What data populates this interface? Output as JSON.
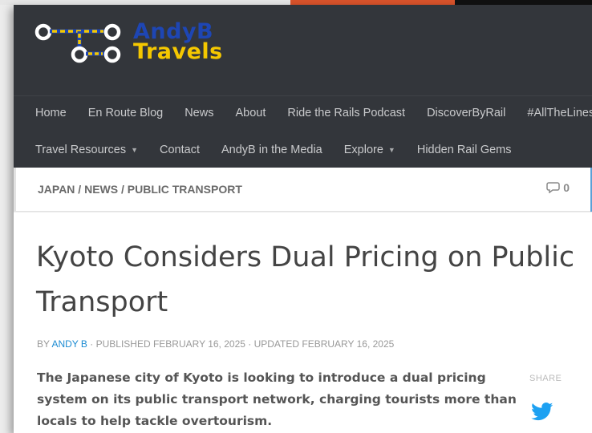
{
  "brand": {
    "line1": "AndyB",
    "line2": "Travels"
  },
  "nav_primary": [
    "Home",
    "En Route Blog",
    "News",
    "About",
    "Ride the Rails Podcast",
    "DiscoverByRail",
    "#AllTheLinesBy"
  ],
  "nav_secondary": [
    {
      "label": "Travel Resources",
      "caret": "▼"
    },
    {
      "label": "Contact"
    },
    {
      "label": "AndyB in the Media"
    },
    {
      "label": "Explore",
      "caret": "▼"
    },
    {
      "label": "Hidden Rail Gems"
    }
  ],
  "breadcrumb": "JAPAN / NEWS / PUBLIC TRANSPORT",
  "comments_count": "0",
  "article": {
    "title": "Kyoto Considers Dual Pricing on Public Transport",
    "by_prefix": "BY ",
    "author": "ANDY B",
    "meta": " · PUBLISHED FEBRUARY 16, 2025 · UPDATED FEBRUARY 16, 2025",
    "lead": "The Japanese city of Kyoto is looking to introduce a dual pricing system on its public transport network, charging tourists more than locals to help tackle overtourism."
  },
  "share_label": "SHARE",
  "icons": {
    "comments": "speech-bubble-icon",
    "share": "twitter-icon",
    "logo": "rail-map-logo"
  },
  "colors": {
    "header_bg": "#33363b",
    "brand_blue": "#1e46b4",
    "brand_yellow": "#f5c800",
    "link": "#1b8bd2",
    "twitter": "#1da1f2"
  }
}
